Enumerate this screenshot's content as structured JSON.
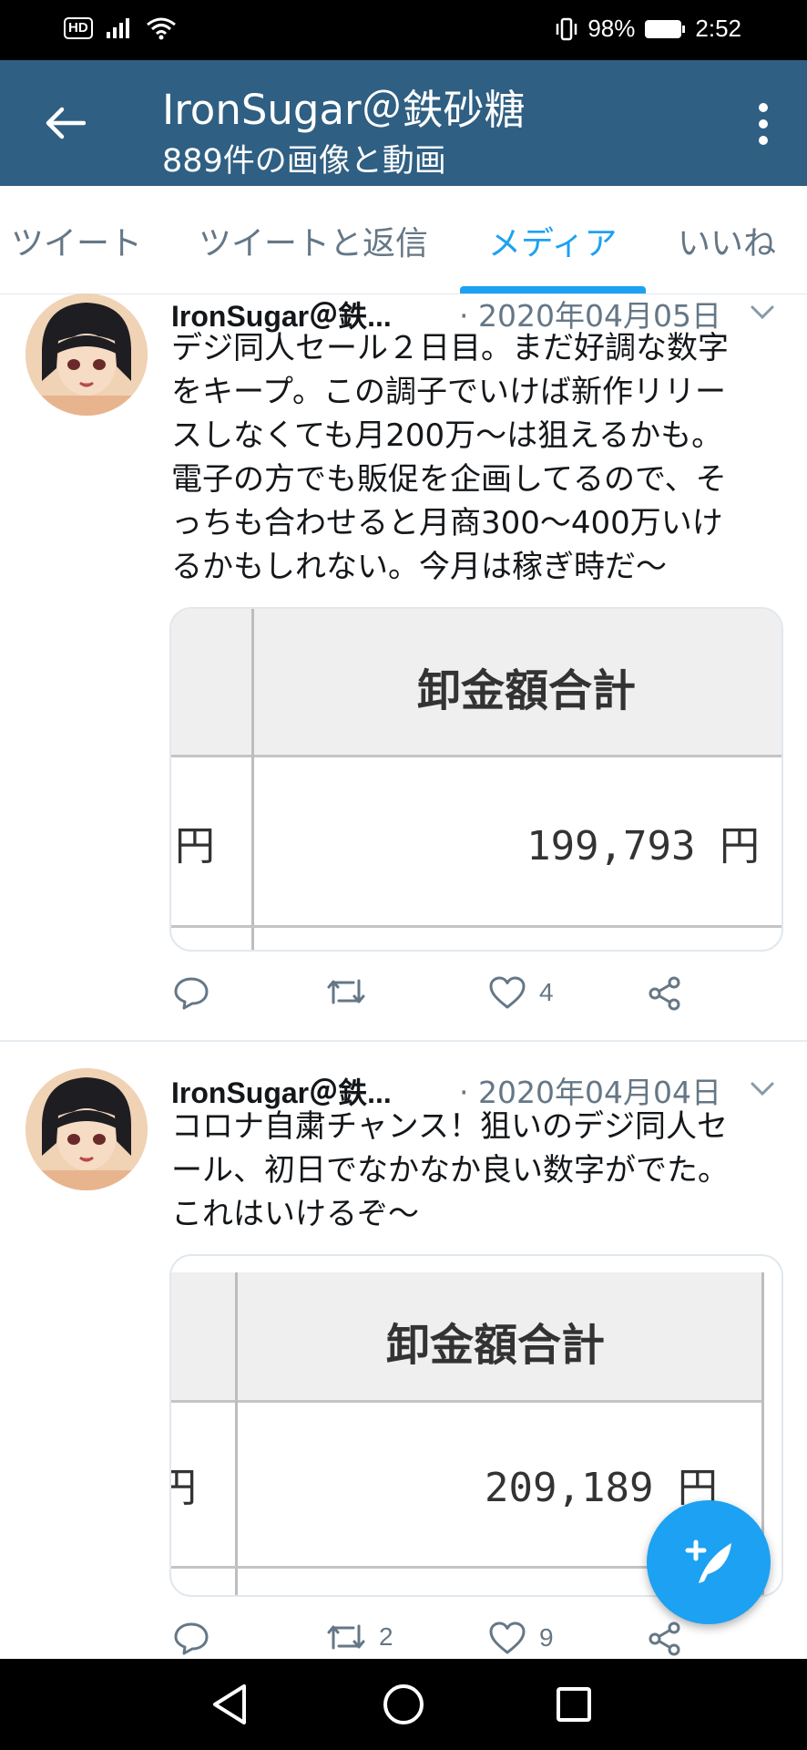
{
  "status_bar": {
    "hd_badge": "HD",
    "battery_percent": "98%",
    "time": "2:52"
  },
  "app_bar": {
    "title": "IronSugar＠鉄砂糖",
    "subtitle": "889件の画像と動画"
  },
  "tabs": [
    {
      "label": "ツイート",
      "active": false
    },
    {
      "label": "ツイートと返信",
      "active": false
    },
    {
      "label": "メディア",
      "active": true
    },
    {
      "label": "いいね",
      "active": false
    }
  ],
  "tweets": [
    {
      "author": "IronSugar＠鉄...",
      "date": "· 2020年04月05日",
      "text_lines": [
        "デジ同人セール２日目。まだ好調な数字",
        "をキープ。この調子でいけば新作リリー",
        "スしなくても月200万〜は狙えるかも。",
        "電子の方でも販促を企画してるので、そ",
        "っちも合わせると月商300〜400万いけ",
        "るかもしれない。今月は稼ぎ時だ〜"
      ],
      "media": {
        "header": "卸金額合計",
        "left_cut": "円",
        "value": "199,793 円"
      },
      "replies": "",
      "retweets": "",
      "likes": "4"
    },
    {
      "author": "IronSugar＠鉄...",
      "date": "· 2020年04月04日",
      "text_lines": [
        "コロナ自粛チャンス！狙いのデジ同人セ",
        "ール、初日でなかなか良い数字がでた。",
        "これはいけるぞ〜"
      ],
      "media": {
        "header": "卸金額合計",
        "left_cut": "円",
        "value": "209,189 円"
      },
      "replies": "",
      "retweets": "2",
      "likes": "9"
    }
  ],
  "colors": {
    "app_bar": "#2f5f82",
    "accent": "#1da1f2",
    "muted": "#657786"
  },
  "icons": {
    "back": "arrow-left-icon",
    "more": "more-vertical-icon",
    "reply": "reply-icon",
    "retweet": "retweet-icon",
    "like": "heart-icon",
    "share": "share-icon",
    "compose": "compose-tweet-icon"
  }
}
